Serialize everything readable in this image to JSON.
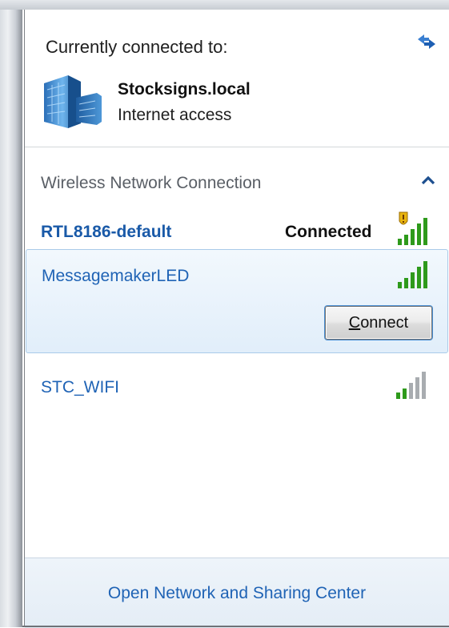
{
  "current": {
    "label": "Currently connected to:",
    "network_name": "Stocksigns.local",
    "network_status": "Internet access"
  },
  "section": {
    "title": "Wireless Network Connection"
  },
  "networks": [
    {
      "ssid": "RTL8186-default",
      "status": "Connected",
      "signal_bars": 5,
      "secured_warning": true
    },
    {
      "ssid": "MessagemakerLED",
      "signal_bars": 5,
      "connect_label": "Connect",
      "connect_accel": "C",
      "connect_rest": "onnect"
    },
    {
      "ssid": "STC_WIFI",
      "signal_bars": 2
    }
  ],
  "footer": {
    "link": "Open Network and Sharing Center"
  },
  "colors": {
    "link_blue": "#1f63b5",
    "signal_green": "#2e9a1b",
    "signal_gray": "#a8acb0",
    "selection_border": "#a9cbe9"
  },
  "icons": [
    "refresh-icon",
    "network-building-icon",
    "collapse-chevron-icon",
    "shield-warning-icon",
    "wifi-signal-icon"
  ]
}
